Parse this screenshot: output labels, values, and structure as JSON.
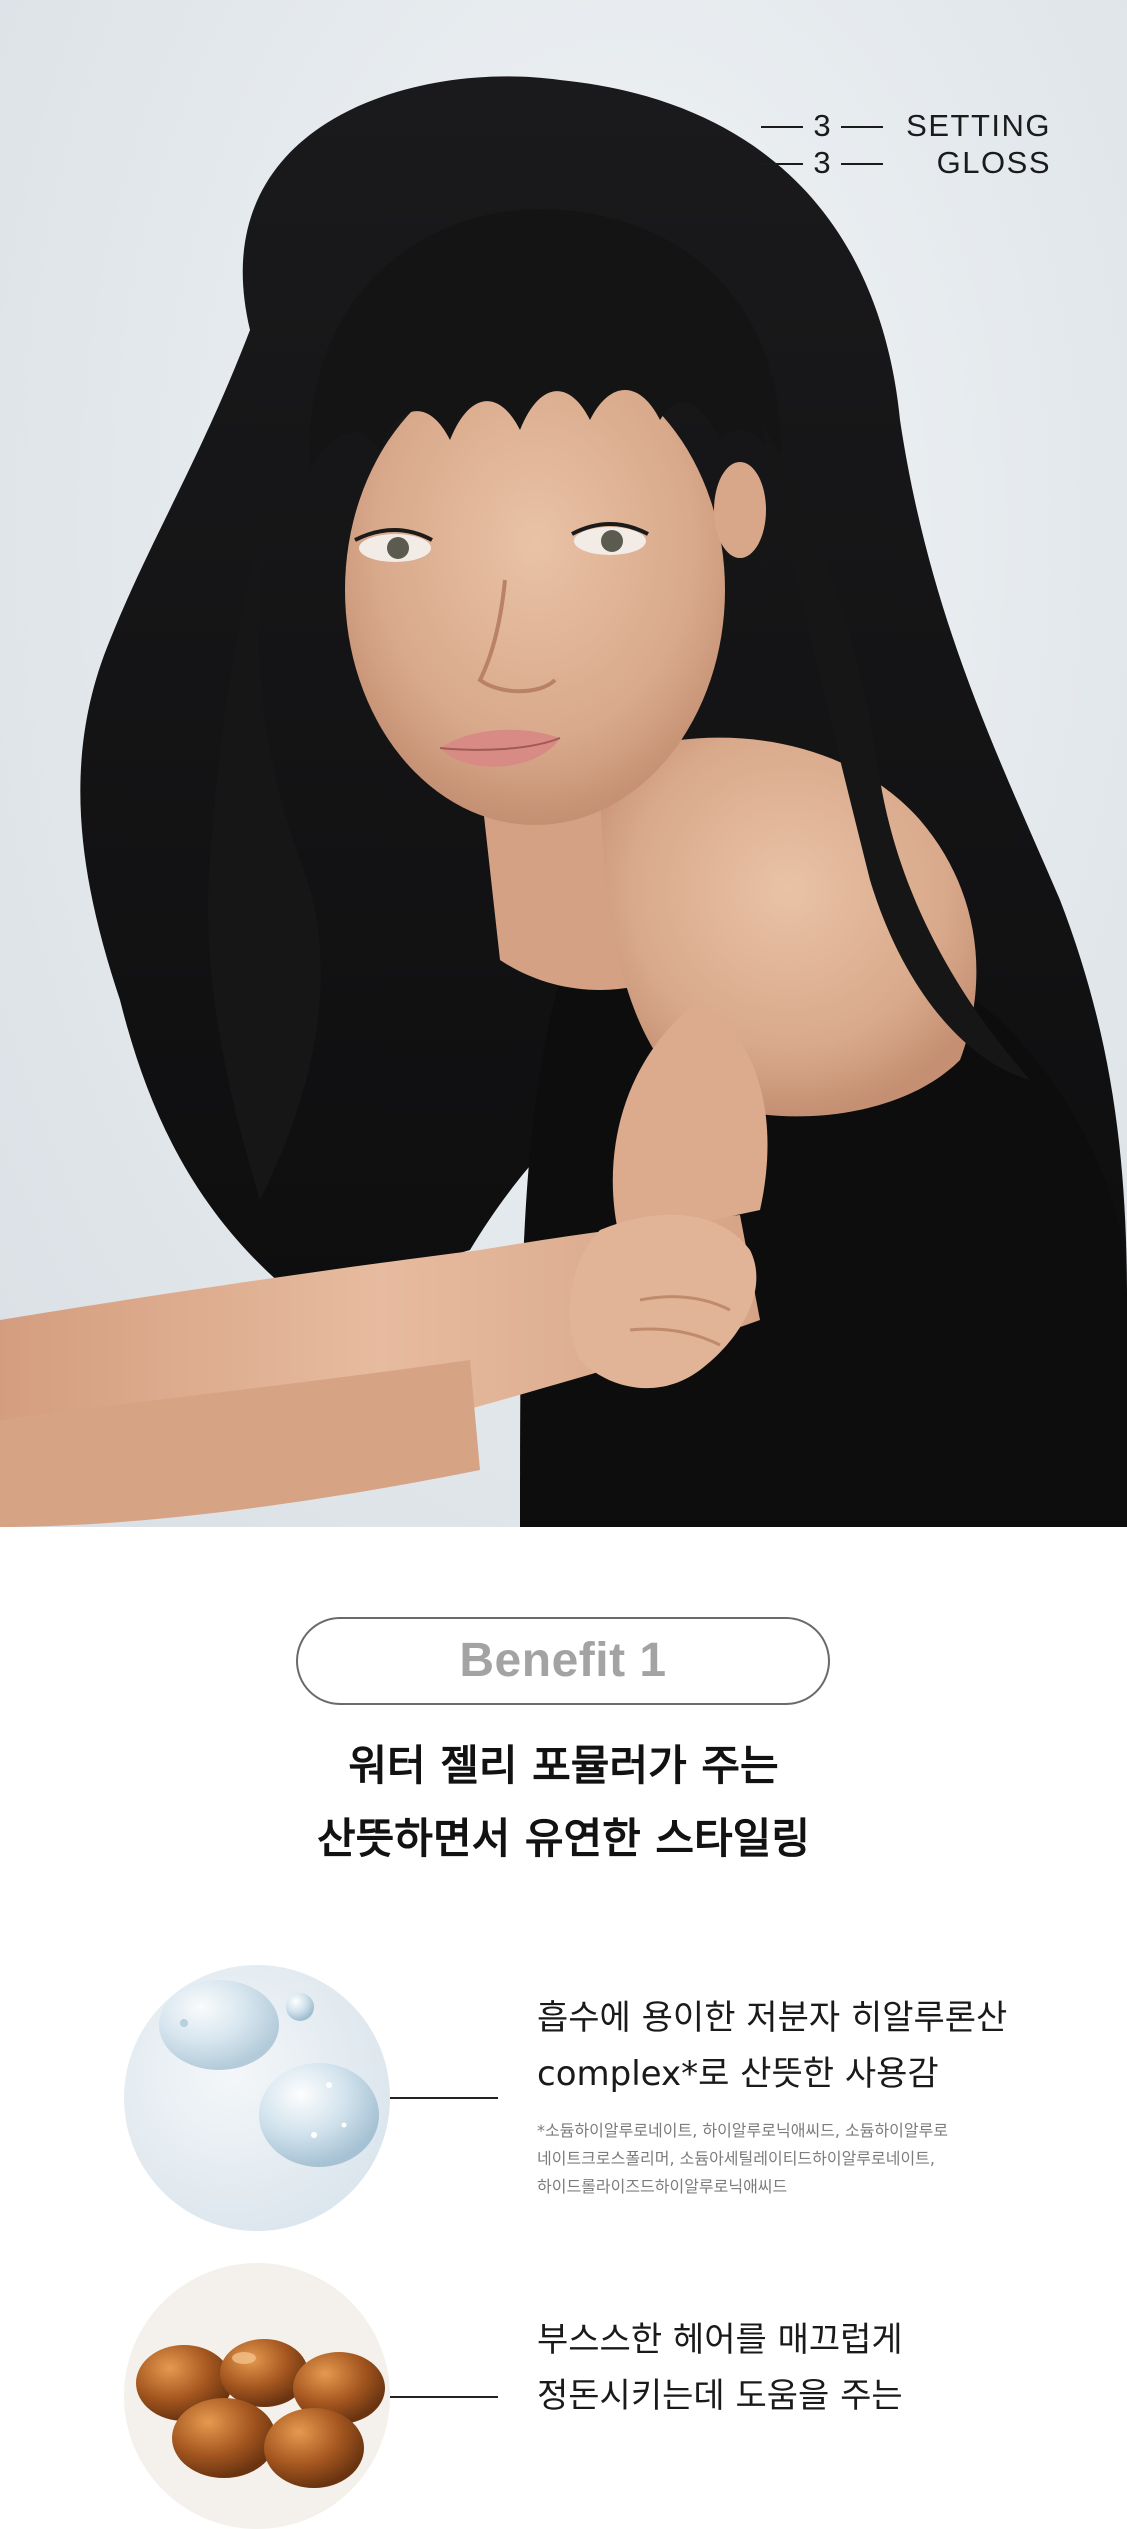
{
  "hero": {
    "tag": {
      "row1_number": "3",
      "row1_word": "SETTING",
      "row2_number": "3",
      "row2_word": "GLOSS"
    }
  },
  "benefit": {
    "badge": "Benefit 1",
    "title_line1": "워터 젤리 포뮬러가 주는",
    "title_line2": "산뜻하면서 유연한 스타일링"
  },
  "features": [
    {
      "image_icon": "water-gel-drops-image",
      "line1": "흡수에 용이한 저분자 히알루론산",
      "line2": "complex*로 산뜻한 사용감",
      "notes": [
        "*소듐하이알루로네이트, 하이알루로닉애씨드, 소듐하이알루로",
        "네이트크로스폴리머, 소듐아세틸레이티드하이알루로네이트,",
        "하이드롤라이즈드하이알루로닉애씨드"
      ]
    },
    {
      "image_icon": "argan-nuts-image",
      "line1": "부스스한 헤어를 매끄럽게",
      "line2": "정돈시키는데 도움을 주는"
    }
  ],
  "colors": {
    "accent_gray": "#a3a3a3",
    "title_black": "#121212",
    "hero_backdrop": "#e3e8ec"
  }
}
